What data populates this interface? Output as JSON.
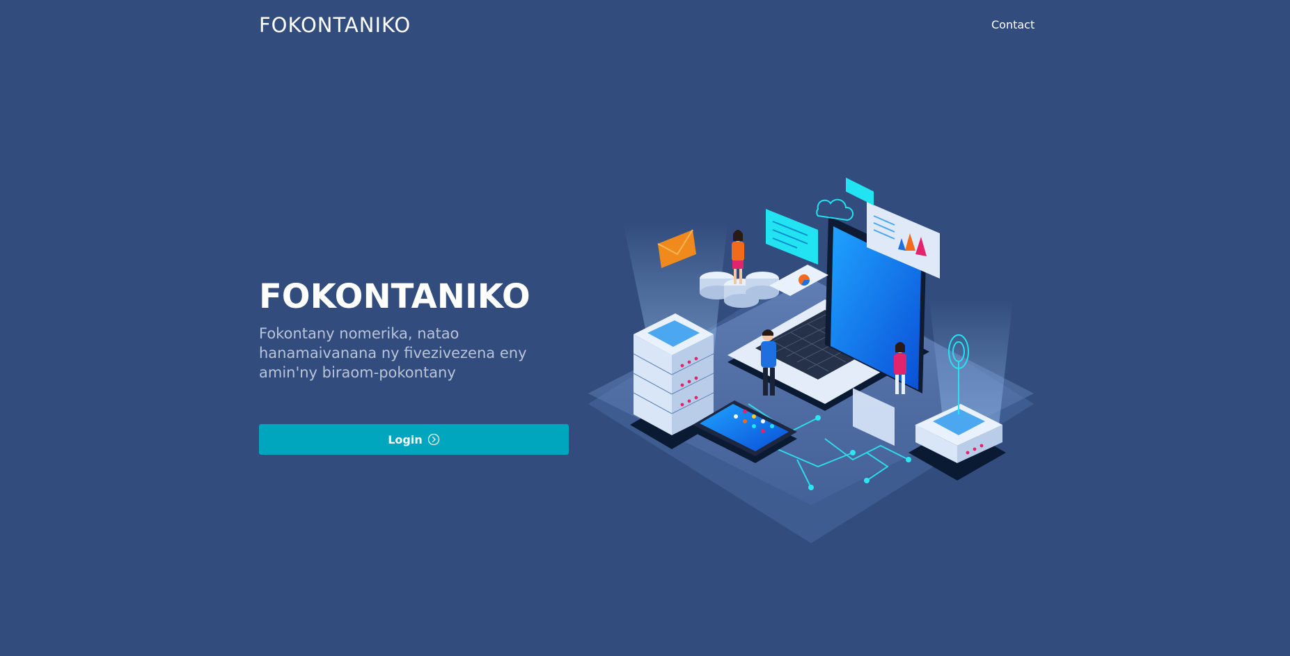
{
  "header": {
    "brand": "FOKONTANIKO",
    "nav": {
      "contact_label": "Contact"
    }
  },
  "hero": {
    "title": "FOKONTANIKO",
    "subtitle": "Fokontany nomerika, natao hanamaivanana ny fivezivezena eny amin'ny biraom-pokontany",
    "login_label": "Login",
    "login_icon": "chevron-circle-right-icon",
    "illustration": "isometric-technology-illustration"
  },
  "colors": {
    "background": "#324d7d",
    "accent": "#00a6bd",
    "subtitle_text": "#b9c4d9"
  }
}
